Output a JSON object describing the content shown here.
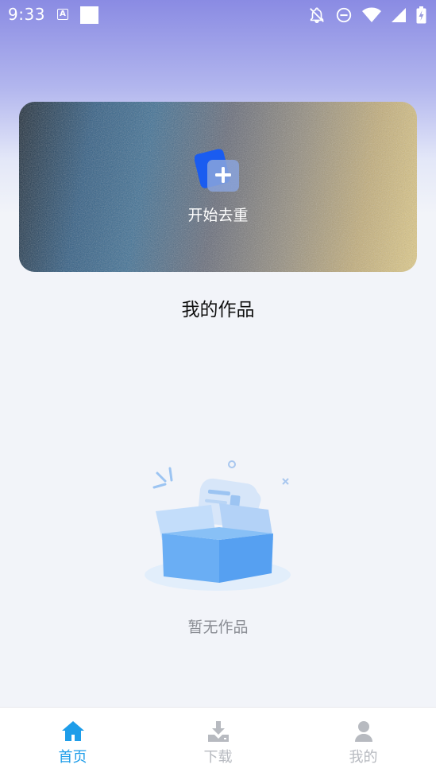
{
  "status_bar": {
    "time": "9:33",
    "indicator_letter": "A",
    "icons": [
      "a-notification-icon",
      "square-notification-icon",
      "bell-off-icon",
      "do-not-disturb-icon",
      "wifi-icon",
      "signal-icon",
      "battery-charging-icon"
    ]
  },
  "banner": {
    "icon": "add-document-icon",
    "label": "开始去重"
  },
  "section": {
    "title": "我的作品"
  },
  "empty_state": {
    "illustration": "empty-box-illustration",
    "text": "暂无作品"
  },
  "bottom_nav": {
    "items": [
      {
        "label": "首页",
        "icon": "home-icon",
        "active": true
      },
      {
        "label": "下载",
        "icon": "download-icon",
        "active": false
      },
      {
        "label": "我的",
        "icon": "user-icon",
        "active": false
      }
    ]
  },
  "colors": {
    "accent": "#1e9de9",
    "inactive": "#b7bac0",
    "background": "#f2f4f9",
    "header_gradient_top": "#8a8be3"
  }
}
